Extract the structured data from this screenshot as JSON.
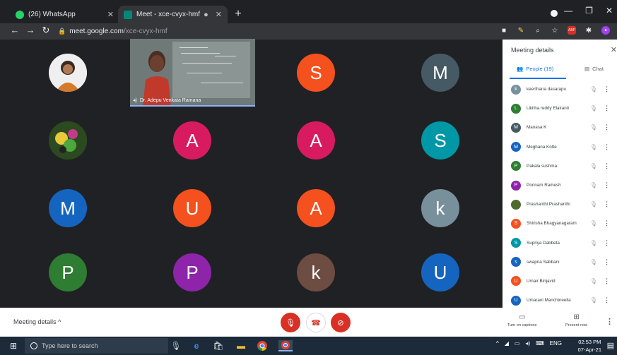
{
  "browser": {
    "tabs": [
      {
        "label": "(26) WhatsApp",
        "icon": "whatsapp-icon",
        "color": "#25d366"
      },
      {
        "label": "Meet - xce-cvyx-hmf",
        "icon": "meet-icon",
        "color": "#00897b"
      }
    ],
    "url_host": "meet.google.com",
    "url_path": "/xce-cvyx-hmf"
  },
  "stage": {
    "video_name": "Dr. Adepu Venkata Ramana",
    "tiles": [
      {
        "letter": "",
        "color": "#e0c9a6",
        "kind": "photo"
      },
      {
        "letter": "S",
        "color": "#f4511e"
      },
      {
        "letter": "M",
        "color": "#455a64"
      },
      {
        "letter": "",
        "color": "#3b5f2a",
        "kind": "photo"
      },
      {
        "letter": "A",
        "color": "#d81b60"
      },
      {
        "letter": "A",
        "color": "#d81b60"
      },
      {
        "letter": "S",
        "color": "#0097a7"
      },
      {
        "letter": "M",
        "color": "#1565c0"
      },
      {
        "letter": "U",
        "color": "#f4511e"
      },
      {
        "letter": "A",
        "color": "#f4511e"
      },
      {
        "letter": "k",
        "color": "#78909c"
      },
      {
        "letter": "P",
        "color": "#2e7d32"
      },
      {
        "letter": "P",
        "color": "#8e24aa"
      },
      {
        "letter": "k",
        "color": "#6d4c41"
      },
      {
        "letter": "U",
        "color": "#1565c0"
      }
    ]
  },
  "sidebar": {
    "title": "Meeting details",
    "people_tab": "People (19)",
    "chat_tab": "Chat",
    "people": [
      {
        "name": "keerthana dasarapu",
        "letter": "k",
        "color": "#78909c"
      },
      {
        "name": "Likitha reddy Elakanti",
        "letter": "L",
        "color": "#2e7d32"
      },
      {
        "name": "Manasa K",
        "letter": "M",
        "color": "#455a64"
      },
      {
        "name": "Meghana Kotte",
        "letter": "M",
        "color": "#1565c0"
      },
      {
        "name": "Pakala sushma",
        "letter": "P",
        "color": "#2e7d32"
      },
      {
        "name": "Ponnam Ramesh",
        "letter": "P",
        "color": "#8e24aa"
      },
      {
        "name": "Prashanthi Prashanthi",
        "letter": "",
        "color": "#4e6b2e"
      },
      {
        "name": "Shirisha Bhagyanagaram",
        "letter": "S",
        "color": "#f4511e"
      },
      {
        "name": "Supriya Dabbeta",
        "letter": "S",
        "color": "#0097a7"
      },
      {
        "name": "swapna Sabbani",
        "letter": "s",
        "color": "#1565c0"
      },
      {
        "name": "Umair Binjavid",
        "letter": "U",
        "color": "#f4511e"
      },
      {
        "name": "Umarani Manchineella",
        "letter": "U",
        "color": "#1565c0"
      }
    ]
  },
  "bottom": {
    "meeting_details": "Meeting details",
    "captions": "Turn on captions",
    "present": "Present now"
  },
  "taskbar": {
    "search_placeholder": "Type here to search",
    "lang": "ENG",
    "time": "02:53 PM",
    "date": "07-Apr-21"
  }
}
